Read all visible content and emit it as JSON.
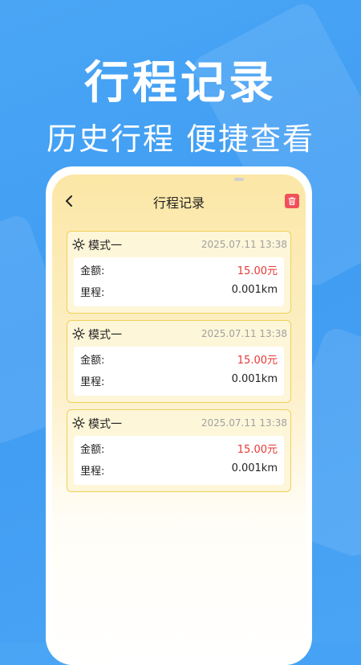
{
  "hero": {
    "title": "行程记录",
    "subtitle": "历史行程 便捷查看"
  },
  "screen": {
    "nav_title": "行程记录",
    "back_icon": "chevron-left-icon",
    "delete_icon": "trash-icon"
  },
  "records": [
    {
      "mode": "模式一",
      "time": "2025.07.11 13:38",
      "amount_label": "金额:",
      "amount": "15.00元",
      "mileage_label": "里程:",
      "mileage": "0.001km"
    },
    {
      "mode": "模式一",
      "time": "2025.07.11 13:38",
      "amount_label": "金额:",
      "amount": "15.00元",
      "mileage_label": "里程:",
      "mileage": "0.001km"
    },
    {
      "mode": "模式一",
      "time": "2025.07.11 13:38",
      "amount_label": "金额:",
      "amount": "15.00元",
      "mileage_label": "里程:",
      "mileage": "0.001km"
    }
  ],
  "colors": {
    "background": "#4aa6f5",
    "card_border": "#f2cf59",
    "amount": "#e53935",
    "delete_button": "#f1505a"
  }
}
